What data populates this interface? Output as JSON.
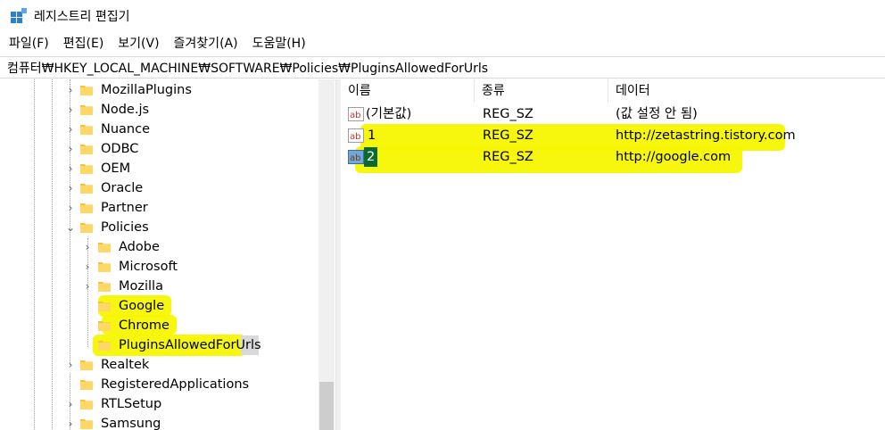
{
  "window": {
    "title": "레지스트리 편집기"
  },
  "menu": [
    {
      "label": "파일(F)"
    },
    {
      "label": "편집(E)"
    },
    {
      "label": "보기(V)"
    },
    {
      "label": "즐겨찾기(A)"
    },
    {
      "label": "도움말(H)"
    }
  ],
  "address": {
    "path": "컴퓨터₩HKEY_LOCAL_MACHINE₩SOFTWARE₩Policies₩PluginsAllowedForUrls"
  },
  "tree": {
    "items": [
      {
        "label": "MozillaPlugins",
        "expanded": false
      },
      {
        "label": "Node.js",
        "expanded": false
      },
      {
        "label": "Nuance",
        "expanded": false
      },
      {
        "label": "ODBC",
        "expanded": false
      },
      {
        "label": "OEM",
        "expanded": false
      },
      {
        "label": "Oracle",
        "expanded": false
      },
      {
        "label": "Partner",
        "expanded": false
      },
      {
        "label": "Policies",
        "expanded": true
      },
      {
        "label": "Adobe",
        "expanded": false
      },
      {
        "label": "Microsoft",
        "expanded": false
      },
      {
        "label": "Mozilla",
        "expanded": false
      },
      {
        "label": "Google",
        "expanded": null
      },
      {
        "label": "Chrome",
        "expanded": null
      },
      {
        "label": "PluginsAllowedForUrls",
        "expanded": null,
        "selected": true
      },
      {
        "label": "Realtek",
        "expanded": false
      },
      {
        "label": "RegisteredApplications",
        "expanded": null
      },
      {
        "label": "RTLSetup",
        "expanded": false
      },
      {
        "label": "Samsung",
        "expanded": false
      }
    ]
  },
  "values": {
    "columns": [
      "이름",
      "종류",
      "데이터"
    ],
    "rows": [
      {
        "name": "(기본값)",
        "type": "REG_SZ",
        "data": "(값 설정 안 됨)"
      },
      {
        "name": "1",
        "type": "REG_SZ",
        "data": "http://zetastring.tistory.com"
      },
      {
        "name": "2",
        "type": "REG_SZ",
        "data": "http://google.com",
        "selected": true
      }
    ]
  },
  "colors": {
    "highlight": "#f7f500",
    "folder": "#f5c33b",
    "selection": "#d9d9d9",
    "name_selection": "#0a6b2e"
  },
  "icons": {
    "app": "registry-editor-icon",
    "folder": "folder-icon",
    "string_value": "string-value-icon",
    "expand": "chevron-right-icon",
    "collapse": "chevron-down-icon"
  }
}
